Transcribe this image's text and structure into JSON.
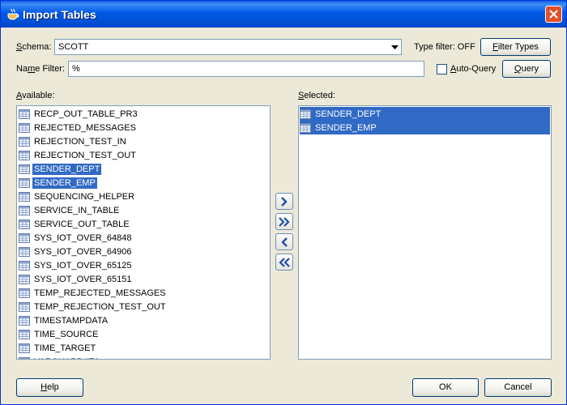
{
  "window": {
    "title": "Import Tables"
  },
  "schema": {
    "label_prefix": "S",
    "label_rest": "chema:",
    "value": "SCOTT"
  },
  "type_filter": {
    "text": "Type filter: OFF"
  },
  "filter_types_button": {
    "prefix": "",
    "underlined": "F",
    "rest": "ilter Types"
  },
  "name_filter": {
    "label_prefix": "Na",
    "label_underlined": "m",
    "label_rest": "e Filter:",
    "value": "%"
  },
  "auto_query": {
    "label_prefix": "",
    "label_underlined": "A",
    "label_rest": "uto-Query",
    "checked": false
  },
  "query_button": {
    "underlined": "Q",
    "rest": "uery"
  },
  "available": {
    "label_underlined": "A",
    "label_rest": "vailable:",
    "items": [
      "RECP_OUT_TABLE_PR3",
      "REJECTED_MESSAGES",
      "REJECTION_TEST_IN",
      "REJECTION_TEST_OUT",
      "SENDER_DEPT",
      "SENDER_EMP",
      "SEQUENCING_HELPER",
      "SERVICE_IN_TABLE",
      "SERVICE_OUT_TABLE",
      "SYS_IOT_OVER_64848",
      "SYS_IOT_OVER_64906",
      "SYS_IOT_OVER_65125",
      "SYS_IOT_OVER_65151",
      "TEMP_REJECTED_MESSAGES",
      "TEMP_REJECTION_TEST_OUT",
      "TIMESTAMPDATA",
      "TIME_SOURCE",
      "TIME_TARGET",
      "VARCHARDATA"
    ],
    "selected_items": [
      "SENDER_DEPT",
      "SENDER_EMP"
    ]
  },
  "selected": {
    "label_underlined": "S",
    "label_rest": "elected:",
    "items": [
      "SENDER_DEPT",
      "SENDER_EMP"
    ]
  },
  "move_buttons": [
    "move-selected-right",
    "move-all-right",
    "move-selected-left",
    "move-all-left"
  ],
  "help_button": {
    "underlined": "H",
    "rest": "elp"
  },
  "ok_button": {
    "label": "OK"
  },
  "cancel_button": {
    "label": "Cancel"
  },
  "colors": {
    "title_bar": "#0058e6",
    "selection": "#316ac5",
    "dialog_bg": "#ece9d8",
    "close_button": "#e0502a"
  }
}
